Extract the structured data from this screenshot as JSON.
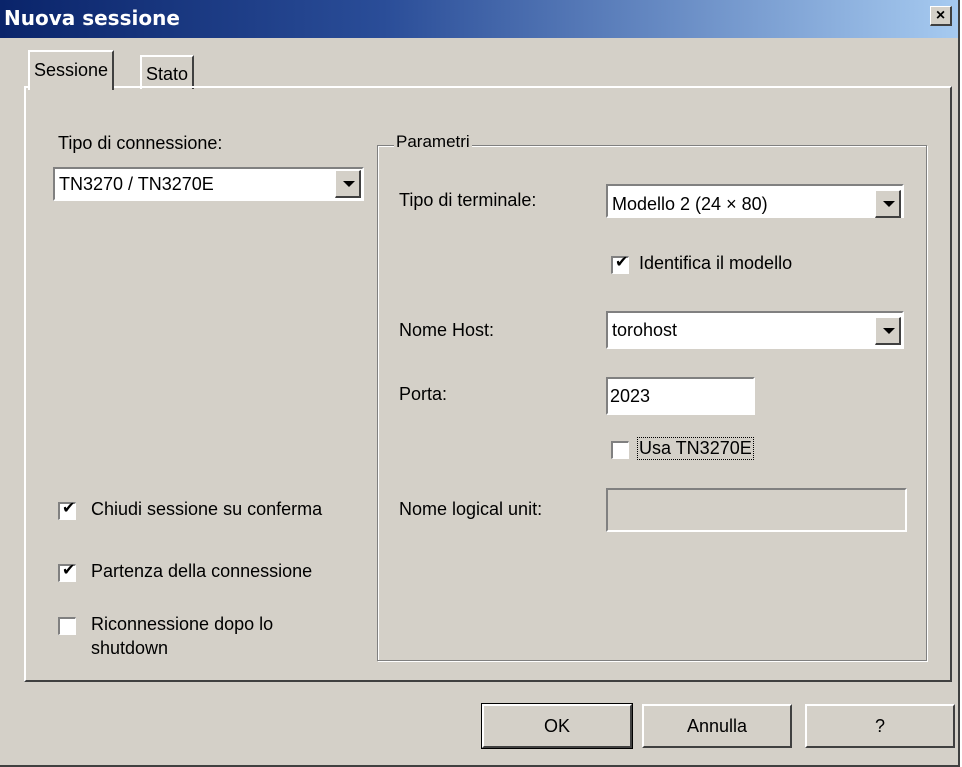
{
  "window": {
    "title": "Nuova sessione",
    "close_label": "×"
  },
  "tabs": [
    {
      "label": "Sessione"
    },
    {
      "label": "Stato"
    }
  ],
  "connection": {
    "label": "Tipo di connessione:",
    "value": "TN3270 / TN3270E"
  },
  "options": [
    {
      "label": "Chiudi sessione su conferma",
      "checked": true
    },
    {
      "label": "Partenza della connessione",
      "checked": true
    },
    {
      "label": "Riconnessione dopo lo",
      "label2": "shutdown",
      "checked": false
    }
  ],
  "params": {
    "legend": "Parametri",
    "terminal_type": {
      "label": "Tipo di terminale:",
      "value": "Modello 2 (24 × 80)"
    },
    "identify_model": {
      "label": "Identifica il modello",
      "checked": true
    },
    "host_name": {
      "label": "Nome Host:",
      "value": "torohost"
    },
    "port": {
      "label": "Porta:",
      "value": "2023"
    },
    "use_tn3270e": {
      "label": "Usa TN3270E",
      "checked": false
    },
    "logical_unit": {
      "label": "Nome logical unit:",
      "value": ""
    }
  },
  "buttons": {
    "ok": "OK",
    "cancel": "Annulla",
    "help": "?"
  },
  "colors": {
    "face": "#d4d0c8",
    "title_start": "#0a246a",
    "title_end": "#a6caf0"
  },
  "check_glyph": "✔"
}
